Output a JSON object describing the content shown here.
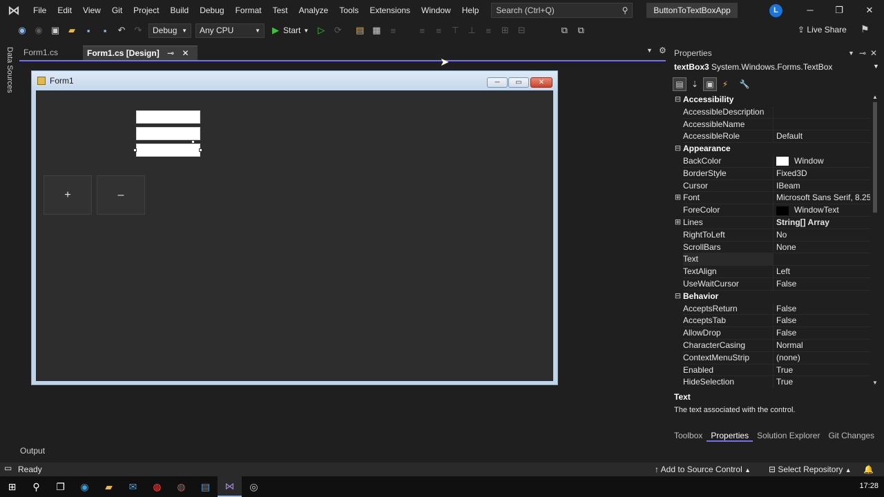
{
  "menubar": {
    "items": [
      "File",
      "Edit",
      "View",
      "Git",
      "Project",
      "Build",
      "Debug",
      "Format",
      "Test",
      "Analyze",
      "Tools",
      "Extensions",
      "Window",
      "Help"
    ],
    "search_placeholder": "Search (Ctrl+Q)",
    "solution_name": "ButtonToTextBoxApp",
    "avatar_letter": "L"
  },
  "toolbar": {
    "config": "Debug",
    "platform": "Any CPU",
    "start_label": "Start",
    "live_share": "Live Share"
  },
  "left_strip": {
    "data_sources": "Data Sources"
  },
  "tabs": [
    {
      "label": "Form1.cs"
    },
    {
      "label": "Form1.cs [Design]"
    }
  ],
  "form": {
    "title": "Form1",
    "buttons": [
      "+",
      "–"
    ]
  },
  "properties": {
    "header": "Properties",
    "object_name": "textBox3",
    "object_type": "System.Windows.Forms.TextBox",
    "rows": [
      {
        "kind": "cat",
        "name": "Accessibility"
      },
      {
        "name": "AccessibleDescription",
        "value": ""
      },
      {
        "name": "AccessibleName",
        "value": ""
      },
      {
        "name": "AccessibleRole",
        "value": "Default"
      },
      {
        "kind": "cat",
        "name": "Appearance"
      },
      {
        "name": "BackColor",
        "value": "Window",
        "swatch": "#ffffff"
      },
      {
        "name": "BorderStyle",
        "value": "Fixed3D"
      },
      {
        "name": "Cursor",
        "value": "IBeam"
      },
      {
        "name": "Font",
        "value": "Microsoft Sans Serif, 8.25pt",
        "expand": "⊞"
      },
      {
        "name": "ForeColor",
        "value": "WindowText",
        "swatch": "#000000"
      },
      {
        "name": "Lines",
        "value": "String[] Array",
        "expand": "⊞",
        "bold": true
      },
      {
        "name": "RightToLeft",
        "value": "No"
      },
      {
        "name": "ScrollBars",
        "value": "None"
      },
      {
        "name": "Text",
        "value": "",
        "selected": true
      },
      {
        "name": "TextAlign",
        "value": "Left"
      },
      {
        "name": "UseWaitCursor",
        "value": "False"
      },
      {
        "kind": "cat",
        "name": "Behavior"
      },
      {
        "name": "AcceptsReturn",
        "value": "False"
      },
      {
        "name": "AcceptsTab",
        "value": "False"
      },
      {
        "name": "AllowDrop",
        "value": "False"
      },
      {
        "name": "CharacterCasing",
        "value": "Normal"
      },
      {
        "name": "ContextMenuStrip",
        "value": "(none)"
      },
      {
        "name": "Enabled",
        "value": "True"
      },
      {
        "name": "HideSelection",
        "value": "True"
      }
    ],
    "desc_title": "Text",
    "desc_text": "The text associated with the control.",
    "panel_tabs": [
      "Toolbox",
      "Properties",
      "Solution Explorer",
      "Git Changes"
    ]
  },
  "output_label": "Output",
  "statusbar": {
    "ready": "Ready",
    "add_source": "Add to Source Control",
    "select_repo": "Select Repository"
  },
  "taskbar": {
    "clock": "17:28"
  }
}
